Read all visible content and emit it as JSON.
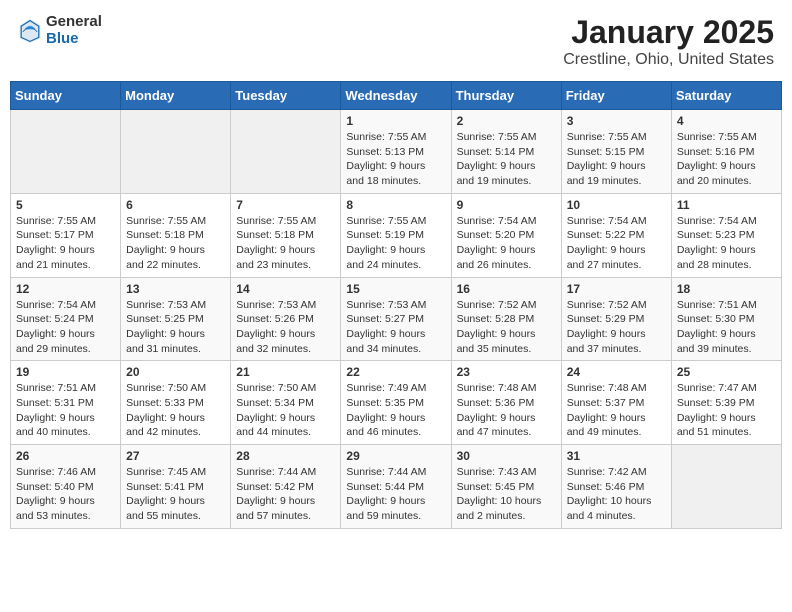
{
  "header": {
    "logo_general": "General",
    "logo_blue": "Blue",
    "title": "January 2025",
    "subtitle": "Crestline, Ohio, United States"
  },
  "weekdays": [
    "Sunday",
    "Monday",
    "Tuesday",
    "Wednesday",
    "Thursday",
    "Friday",
    "Saturday"
  ],
  "weeks": [
    [
      {
        "day": "",
        "empty": true
      },
      {
        "day": "",
        "empty": true
      },
      {
        "day": "",
        "empty": true
      },
      {
        "day": "1",
        "sunrise": "7:55 AM",
        "sunset": "5:13 PM",
        "daylight": "9 hours and 18 minutes."
      },
      {
        "day": "2",
        "sunrise": "7:55 AM",
        "sunset": "5:14 PM",
        "daylight": "9 hours and 19 minutes."
      },
      {
        "day": "3",
        "sunrise": "7:55 AM",
        "sunset": "5:15 PM",
        "daylight": "9 hours and 19 minutes."
      },
      {
        "day": "4",
        "sunrise": "7:55 AM",
        "sunset": "5:16 PM",
        "daylight": "9 hours and 20 minutes."
      }
    ],
    [
      {
        "day": "5",
        "sunrise": "7:55 AM",
        "sunset": "5:17 PM",
        "daylight": "9 hours and 21 minutes."
      },
      {
        "day": "6",
        "sunrise": "7:55 AM",
        "sunset": "5:18 PM",
        "daylight": "9 hours and 22 minutes."
      },
      {
        "day": "7",
        "sunrise": "7:55 AM",
        "sunset": "5:18 PM",
        "daylight": "9 hours and 23 minutes."
      },
      {
        "day": "8",
        "sunrise": "7:55 AM",
        "sunset": "5:19 PM",
        "daylight": "9 hours and 24 minutes."
      },
      {
        "day": "9",
        "sunrise": "7:54 AM",
        "sunset": "5:20 PM",
        "daylight": "9 hours and 26 minutes."
      },
      {
        "day": "10",
        "sunrise": "7:54 AM",
        "sunset": "5:22 PM",
        "daylight": "9 hours and 27 minutes."
      },
      {
        "day": "11",
        "sunrise": "7:54 AM",
        "sunset": "5:23 PM",
        "daylight": "9 hours and 28 minutes."
      }
    ],
    [
      {
        "day": "12",
        "sunrise": "7:54 AM",
        "sunset": "5:24 PM",
        "daylight": "9 hours and 29 minutes."
      },
      {
        "day": "13",
        "sunrise": "7:53 AM",
        "sunset": "5:25 PM",
        "daylight": "9 hours and 31 minutes."
      },
      {
        "day": "14",
        "sunrise": "7:53 AM",
        "sunset": "5:26 PM",
        "daylight": "9 hours and 32 minutes."
      },
      {
        "day": "15",
        "sunrise": "7:53 AM",
        "sunset": "5:27 PM",
        "daylight": "9 hours and 34 minutes."
      },
      {
        "day": "16",
        "sunrise": "7:52 AM",
        "sunset": "5:28 PM",
        "daylight": "9 hours and 35 minutes."
      },
      {
        "day": "17",
        "sunrise": "7:52 AM",
        "sunset": "5:29 PM",
        "daylight": "9 hours and 37 minutes."
      },
      {
        "day": "18",
        "sunrise": "7:51 AM",
        "sunset": "5:30 PM",
        "daylight": "9 hours and 39 minutes."
      }
    ],
    [
      {
        "day": "19",
        "sunrise": "7:51 AM",
        "sunset": "5:31 PM",
        "daylight": "9 hours and 40 minutes."
      },
      {
        "day": "20",
        "sunrise": "7:50 AM",
        "sunset": "5:33 PM",
        "daylight": "9 hours and 42 minutes."
      },
      {
        "day": "21",
        "sunrise": "7:50 AM",
        "sunset": "5:34 PM",
        "daylight": "9 hours and 44 minutes."
      },
      {
        "day": "22",
        "sunrise": "7:49 AM",
        "sunset": "5:35 PM",
        "daylight": "9 hours and 46 minutes."
      },
      {
        "day": "23",
        "sunrise": "7:48 AM",
        "sunset": "5:36 PM",
        "daylight": "9 hours and 47 minutes."
      },
      {
        "day": "24",
        "sunrise": "7:48 AM",
        "sunset": "5:37 PM",
        "daylight": "9 hours and 49 minutes."
      },
      {
        "day": "25",
        "sunrise": "7:47 AM",
        "sunset": "5:39 PM",
        "daylight": "9 hours and 51 minutes."
      }
    ],
    [
      {
        "day": "26",
        "sunrise": "7:46 AM",
        "sunset": "5:40 PM",
        "daylight": "9 hours and 53 minutes."
      },
      {
        "day": "27",
        "sunrise": "7:45 AM",
        "sunset": "5:41 PM",
        "daylight": "9 hours and 55 minutes."
      },
      {
        "day": "28",
        "sunrise": "7:44 AM",
        "sunset": "5:42 PM",
        "daylight": "9 hours and 57 minutes."
      },
      {
        "day": "29",
        "sunrise": "7:44 AM",
        "sunset": "5:44 PM",
        "daylight": "9 hours and 59 minutes."
      },
      {
        "day": "30",
        "sunrise": "7:43 AM",
        "sunset": "5:45 PM",
        "daylight": "10 hours and 2 minutes."
      },
      {
        "day": "31",
        "sunrise": "7:42 AM",
        "sunset": "5:46 PM",
        "daylight": "10 hours and 4 minutes."
      },
      {
        "day": "",
        "empty": true
      }
    ]
  ],
  "labels": {
    "sunrise": "Sunrise:",
    "sunset": "Sunset:",
    "daylight": "Daylight:"
  }
}
